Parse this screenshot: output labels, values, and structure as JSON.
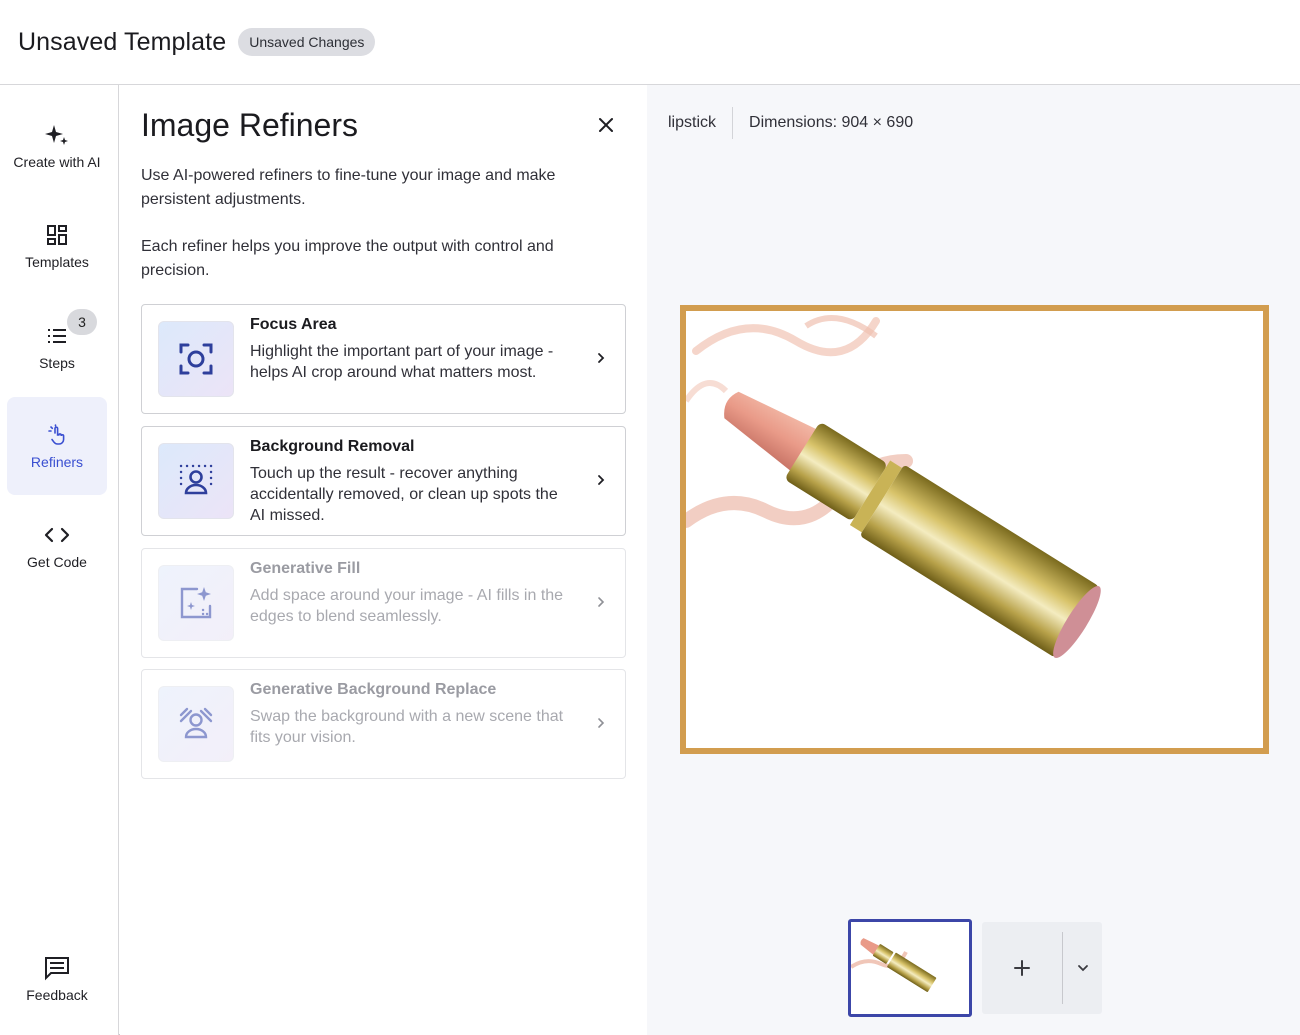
{
  "header": {
    "title": "Unsaved Template",
    "badge": "Unsaved Changes"
  },
  "sidenav": {
    "items": [
      {
        "label": "Create with AI",
        "icon": "sparkle-icon"
      },
      {
        "label": "Templates",
        "icon": "grid-icon"
      },
      {
        "label": "Steps",
        "icon": "list-icon",
        "count": "3"
      },
      {
        "label": "Refiners",
        "icon": "pointer-click-icon",
        "active": true
      },
      {
        "label": "Get Code",
        "icon": "code-icon"
      }
    ],
    "feedback": {
      "label": "Feedback",
      "icon": "feedback-icon"
    }
  },
  "panel": {
    "title": "Image Refiners",
    "description1": "Use AI-powered refiners to fine-tune your image and make persistent adjustments.",
    "description2": "Each refiner helps you improve the output with control and precision.",
    "cards": [
      {
        "title": "Focus Area",
        "description": "Highlight the important part of your image - helps AI crop around what matters most.",
        "icon": "focus-icon",
        "enabled": true
      },
      {
        "title": "Background Removal",
        "description": "Touch up the result - recover anything accidentally removed, or clean up spots the AI missed.",
        "icon": "person-dotted-icon",
        "enabled": true
      },
      {
        "title": "Generative Fill",
        "description": "Add space around your image - AI fills in the edges to blend seamlessly.",
        "icon": "expand-sparkle-icon",
        "enabled": false
      },
      {
        "title": "Generative Background Replace",
        "description": "Swap the background with a new scene that fits your vision.",
        "icon": "person-replace-icon",
        "enabled": false
      }
    ]
  },
  "canvas": {
    "image_name": "lipstick",
    "dimensions": "Dimensions: 904 × 690"
  },
  "colors": {
    "accent": "#3a4fd1",
    "frame_gold": "#d29d4f",
    "thumb_border": "#3c46a8"
  }
}
